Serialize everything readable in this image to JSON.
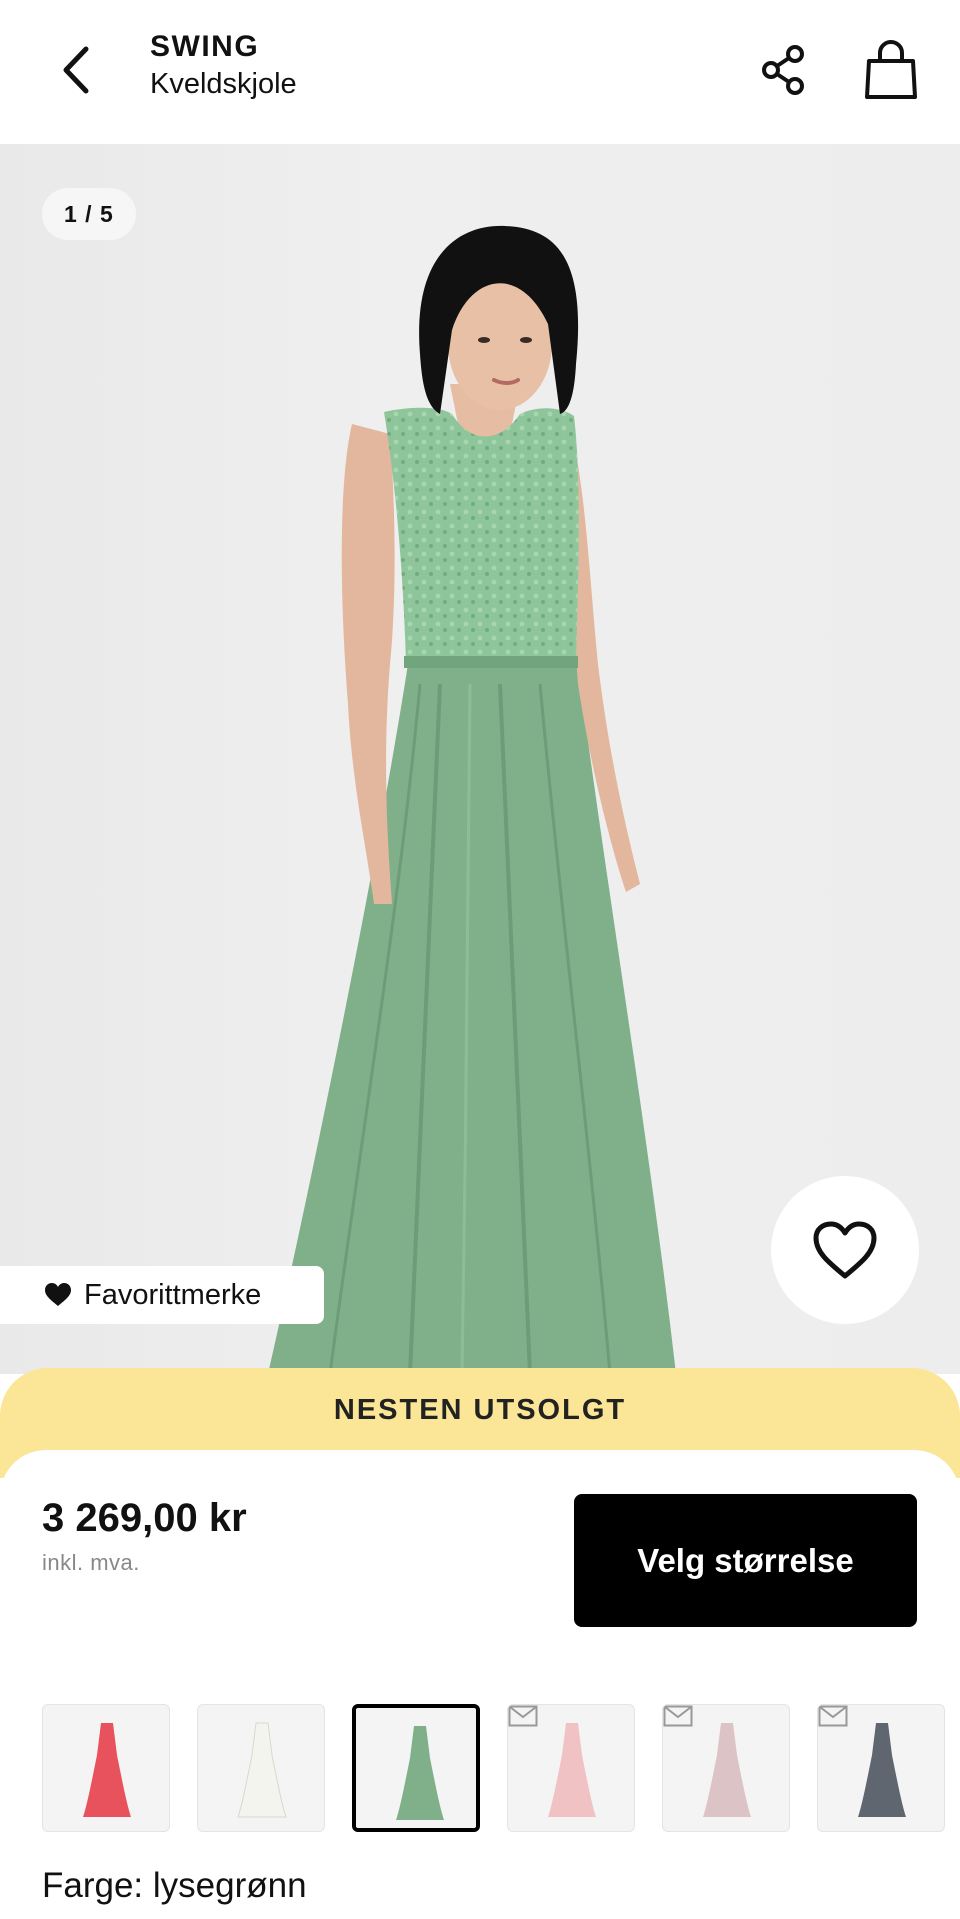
{
  "header": {
    "brand": "SWING",
    "subtitle": "Kveldskjole"
  },
  "gallery": {
    "counter": "1 / 5",
    "favorite_label": "Favorittmerke"
  },
  "banner": {
    "text": "NESTEN UTSOLGT"
  },
  "purchase": {
    "price": "3 269,00 kr",
    "vat_note": "inkl. mva.",
    "size_button": "Velg størrelse"
  },
  "swatches": [
    {
      "color": "#e8525c",
      "selected": false,
      "notify": false
    },
    {
      "color": "#f4f4ee",
      "selected": false,
      "notify": false
    },
    {
      "color": "#7fb08a",
      "selected": true,
      "notify": false
    },
    {
      "color": "#f0c2c4",
      "selected": false,
      "notify": true
    },
    {
      "color": "#dcc3c6",
      "selected": false,
      "notify": true
    },
    {
      "color": "#5f6670",
      "selected": false,
      "notify": true
    }
  ],
  "color_label": "Farge: lysegrønn",
  "colors": {
    "banner": "#fbe596",
    "button": "#000000",
    "dress": "#7fb08a"
  }
}
